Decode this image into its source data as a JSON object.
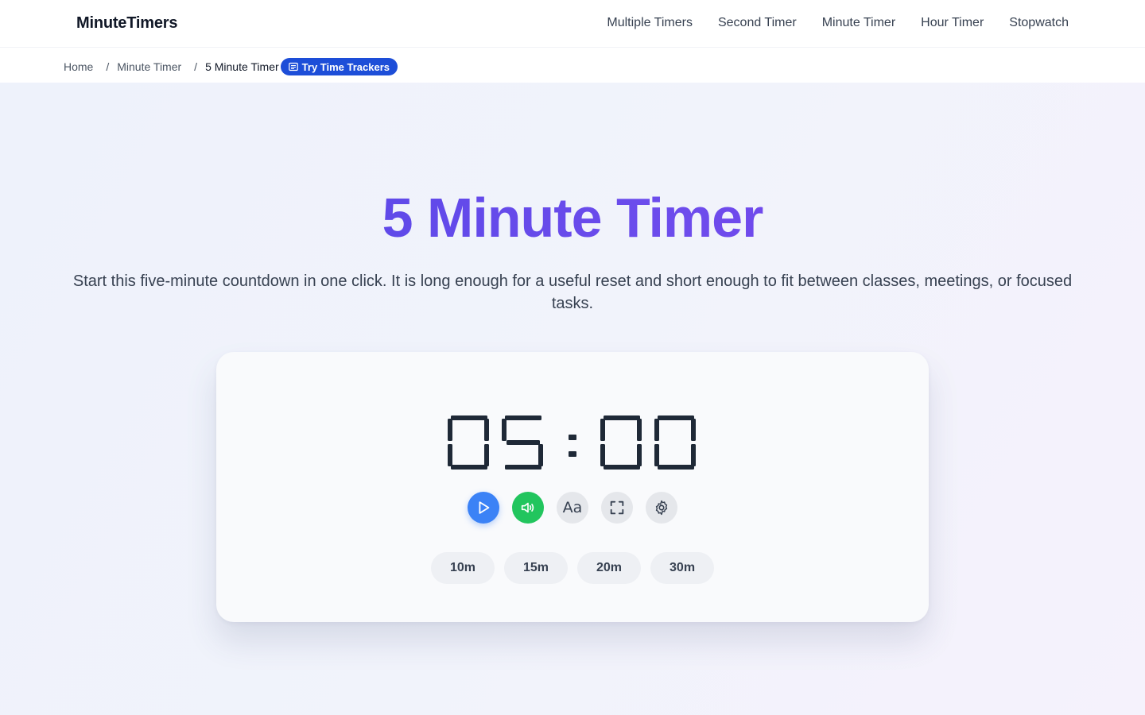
{
  "header": {
    "brand": "MinuteTimers",
    "nav": [
      "Multiple Timers",
      "Second Timer",
      "Minute Timer",
      "Hour Timer",
      "Stopwatch"
    ]
  },
  "breadcrumb": {
    "home": "Home",
    "parent": "Minute Timer",
    "current": "5 Minute Timer",
    "separator": "/",
    "cta": "Try Time Trackers"
  },
  "hero": {
    "title": "5 Minute Timer",
    "description": "Start this five-minute countdown in one click. It is long enough for a useful reset and short enough to fit between classes, meetings, or focused tasks."
  },
  "timer": {
    "display": "05:00",
    "digits": [
      "0",
      "5",
      "0",
      "0"
    ],
    "controls": [
      {
        "name": "play-button",
        "icon": "play-icon",
        "color": "#3b82f6"
      },
      {
        "name": "sound-button",
        "icon": "speaker-icon",
        "color": "#22c55e"
      },
      {
        "name": "font-button",
        "icon": "font-icon",
        "label": "Aa"
      },
      {
        "name": "fullscreen-button",
        "icon": "fullscreen-icon"
      },
      {
        "name": "settings-button",
        "icon": "gear-icon"
      }
    ],
    "presets": [
      "10m",
      "15m",
      "20m",
      "30m"
    ]
  },
  "colors": {
    "accent": "#4f46e5",
    "accent2": "#7c3aed",
    "cta": "#1d4ed8",
    "digit": "#1f2937"
  }
}
